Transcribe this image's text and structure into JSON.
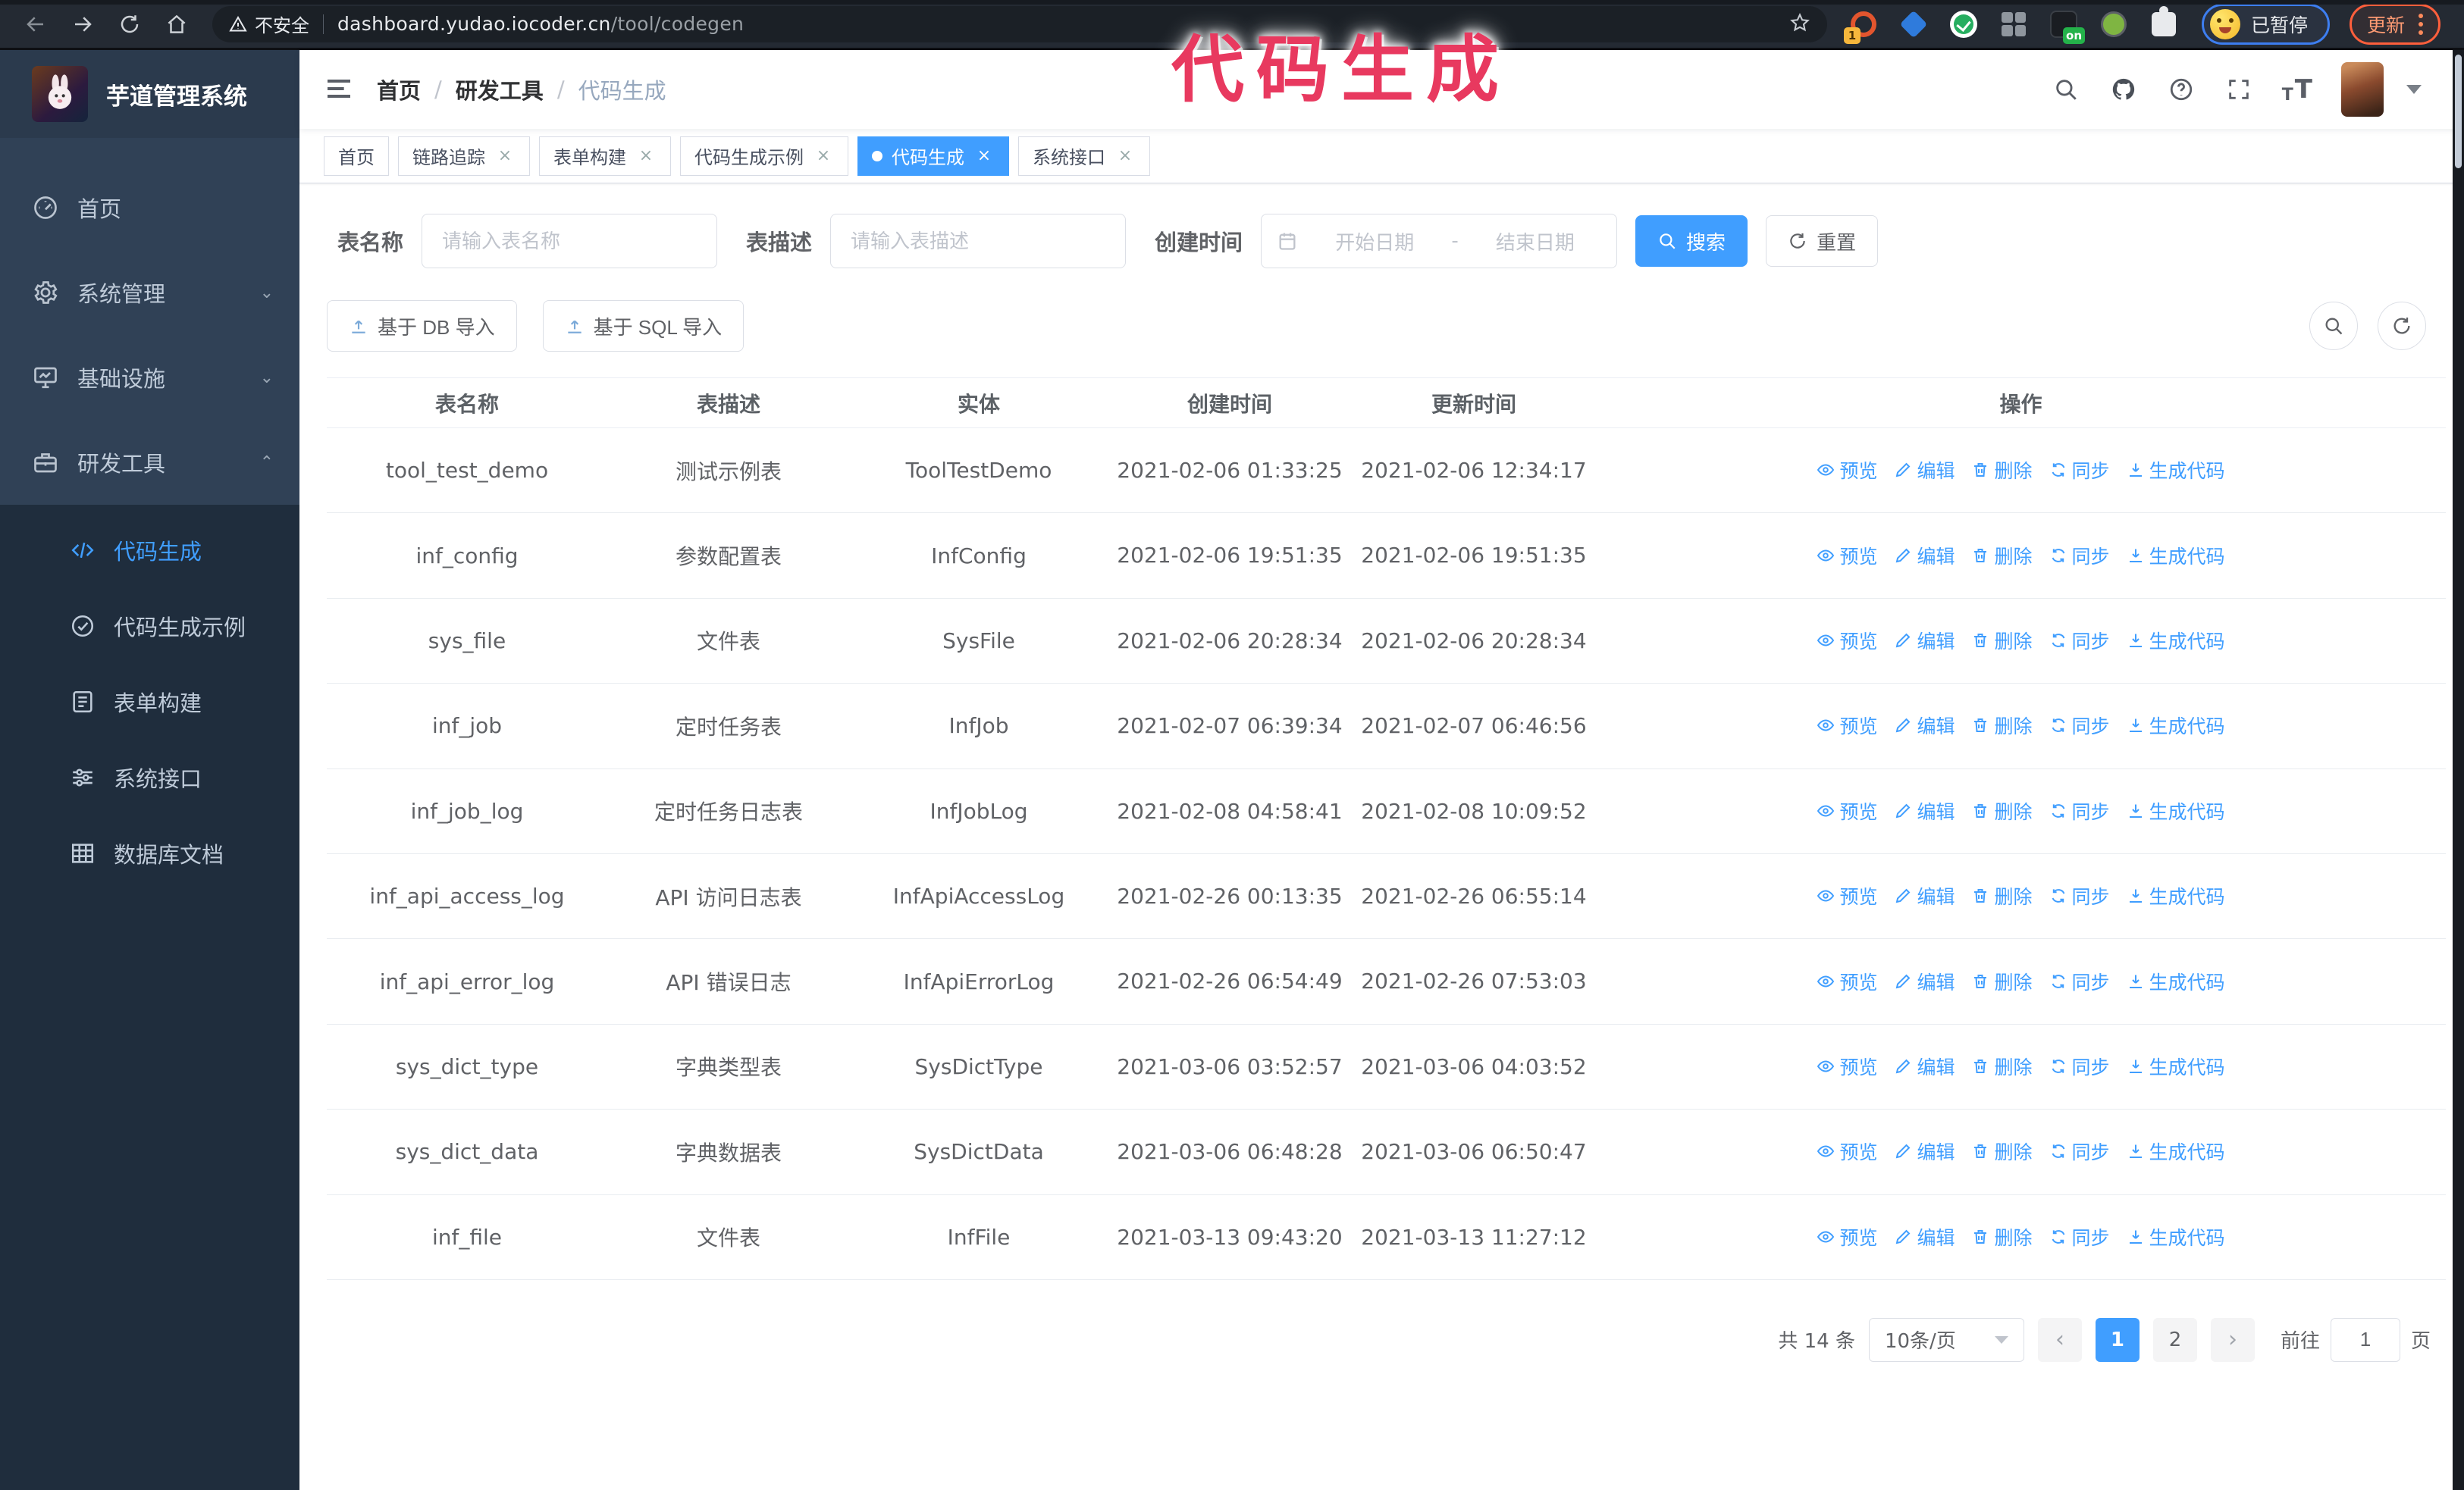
{
  "browser": {
    "security_text": "不安全",
    "url_domain": "dashboard.yudao.iocoder.cn",
    "url_path": "/tool/codegen",
    "extension_badge": "1",
    "extension_on_badge": "on",
    "profile_label": "已暂停",
    "update_label": "更新"
  },
  "annotation": {
    "text": "代码生成",
    "color": "#e8395f"
  },
  "sidebar": {
    "logo_title": "芋道管理系统",
    "menu": [
      {
        "label": "首页"
      },
      {
        "label": "系统管理"
      },
      {
        "label": "基础设施"
      },
      {
        "label": "研发工具"
      }
    ],
    "submenu": [
      {
        "label": "代码生成"
      },
      {
        "label": "代码生成示例"
      },
      {
        "label": "表单构建"
      },
      {
        "label": "系统接口"
      },
      {
        "label": "数据库文档"
      }
    ]
  },
  "header": {
    "breadcrumb": [
      "首页",
      "研发工具",
      "代码生成"
    ]
  },
  "tags": [
    {
      "label": "首页"
    },
    {
      "label": "链路追踪"
    },
    {
      "label": "表单构建"
    },
    {
      "label": "代码生成示例"
    },
    {
      "label": "代码生成"
    },
    {
      "label": "系统接口"
    }
  ],
  "search": {
    "name_label": "表名称",
    "name_placeholder": "请输入表名称",
    "desc_label": "表描述",
    "desc_placeholder": "请输入表描述",
    "time_label": "创建时间",
    "start_placeholder": "开始日期",
    "range_separator": "-",
    "end_placeholder": "结束日期",
    "search_button": "搜索",
    "reset_button": "重置"
  },
  "toolbar": {
    "import_db": "基于 DB 导入",
    "import_sql": "基于 SQL 导入"
  },
  "table": {
    "columns": [
      "表名称",
      "表描述",
      "实体",
      "创建时间",
      "更新时间",
      "操作"
    ],
    "actions": [
      "预览",
      "编辑",
      "删除",
      "同步",
      "生成代码"
    ],
    "rows": [
      {
        "name": "tool_test_demo",
        "desc": "测试示例表",
        "entity": "ToolTestDemo",
        "created": "2021-02-06 01:33:25",
        "updated": "2021-02-06 12:34:17"
      },
      {
        "name": "inf_config",
        "desc": "参数配置表",
        "entity": "InfConfig",
        "created": "2021-02-06 19:51:35",
        "updated": "2021-02-06 19:51:35"
      },
      {
        "name": "sys_file",
        "desc": "文件表",
        "entity": "SysFile",
        "created": "2021-02-06 20:28:34",
        "updated": "2021-02-06 20:28:34"
      },
      {
        "name": "inf_job",
        "desc": "定时任务表",
        "entity": "InfJob",
        "created": "2021-02-07 06:39:34",
        "updated": "2021-02-07 06:46:56"
      },
      {
        "name": "inf_job_log",
        "desc": "定时任务日志表",
        "entity": "InfJobLog",
        "created": "2021-02-08 04:58:41",
        "updated": "2021-02-08 10:09:52"
      },
      {
        "name": "inf_api_access_log",
        "desc": "API 访问日志表",
        "entity": "InfApiAccessLog",
        "created": "2021-02-26 00:13:35",
        "updated": "2021-02-26 06:55:14"
      },
      {
        "name": "inf_api_error_log",
        "desc": "API 错误日志",
        "entity": "InfApiErrorLog",
        "created": "2021-02-26 06:54:49",
        "updated": "2021-02-26 07:53:03"
      },
      {
        "name": "sys_dict_type",
        "desc": "字典类型表",
        "entity": "SysDictType",
        "created": "2021-03-06 03:52:57",
        "updated": "2021-03-06 04:03:52"
      },
      {
        "name": "sys_dict_data",
        "desc": "字典数据表",
        "entity": "SysDictData",
        "created": "2021-03-06 06:48:28",
        "updated": "2021-03-06 06:50:47"
      },
      {
        "name": "inf_file",
        "desc": "文件表",
        "entity": "InfFile",
        "created": "2021-03-13 09:43:20",
        "updated": "2021-03-13 11:27:12"
      }
    ]
  },
  "pagination": {
    "total_label": "共 14 条",
    "page_size": "10条/页",
    "prev": "‹",
    "next": "›",
    "pages": [
      "1",
      "2"
    ],
    "goto_label": "前往",
    "goto_value": "1",
    "goto_suffix": "页"
  }
}
